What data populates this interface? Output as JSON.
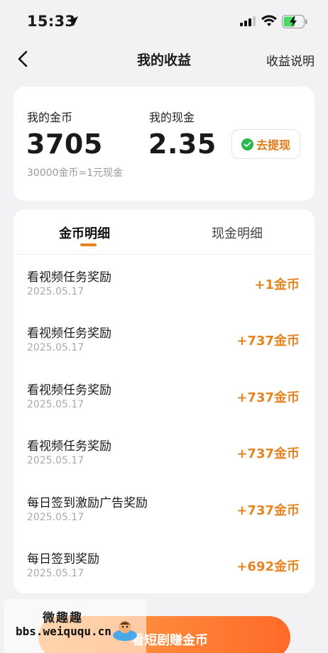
{
  "status": {
    "time": "15:33"
  },
  "nav": {
    "title": "我的收益",
    "help_link": "收益说明"
  },
  "summary": {
    "coin_label": "我的金币",
    "coin_value": "3705",
    "cash_label": "我的现金",
    "cash_value": "2.35",
    "rate_note": "30000金币=1元现金",
    "withdraw_label": "去提现"
  },
  "tabs": [
    {
      "label": "金币明细",
      "active": true
    },
    {
      "label": "现金明细",
      "active": false
    }
  ],
  "records": [
    {
      "title": "看视频任务奖励",
      "date": "2025.05.17",
      "amount": "+1金币"
    },
    {
      "title": "看视频任务奖励",
      "date": "2025.05.17",
      "amount": "+737金币"
    },
    {
      "title": "看视频任务奖励",
      "date": "2025.05.17",
      "amount": "+737金币"
    },
    {
      "title": "看视频任务奖励",
      "date": "2025.05.17",
      "amount": "+737金币"
    },
    {
      "title": "每日签到激励广告奖励",
      "date": "2025.05.17",
      "amount": "+737金币"
    },
    {
      "title": "每日签到奖励",
      "date": "2025.05.17",
      "amount": "+692金币"
    }
  ],
  "bottom": {
    "label": "看短剧赚金币"
  },
  "watermark": {
    "line1": "微趣趣",
    "line2": "bbs.weiququ.cn"
  },
  "icons": {
    "back": "chevron-left-icon",
    "location": "location-arrow-icon",
    "signal": "cellular-signal-icon",
    "wifi": "wifi-icon",
    "battery": "battery-charging-icon",
    "withdraw": "wechat-chat-icon",
    "bottom": "drama-play-icon"
  },
  "colors": {
    "accent": "#e58420",
    "background": "#f2f2f4",
    "battery_green": "#4cd964"
  }
}
